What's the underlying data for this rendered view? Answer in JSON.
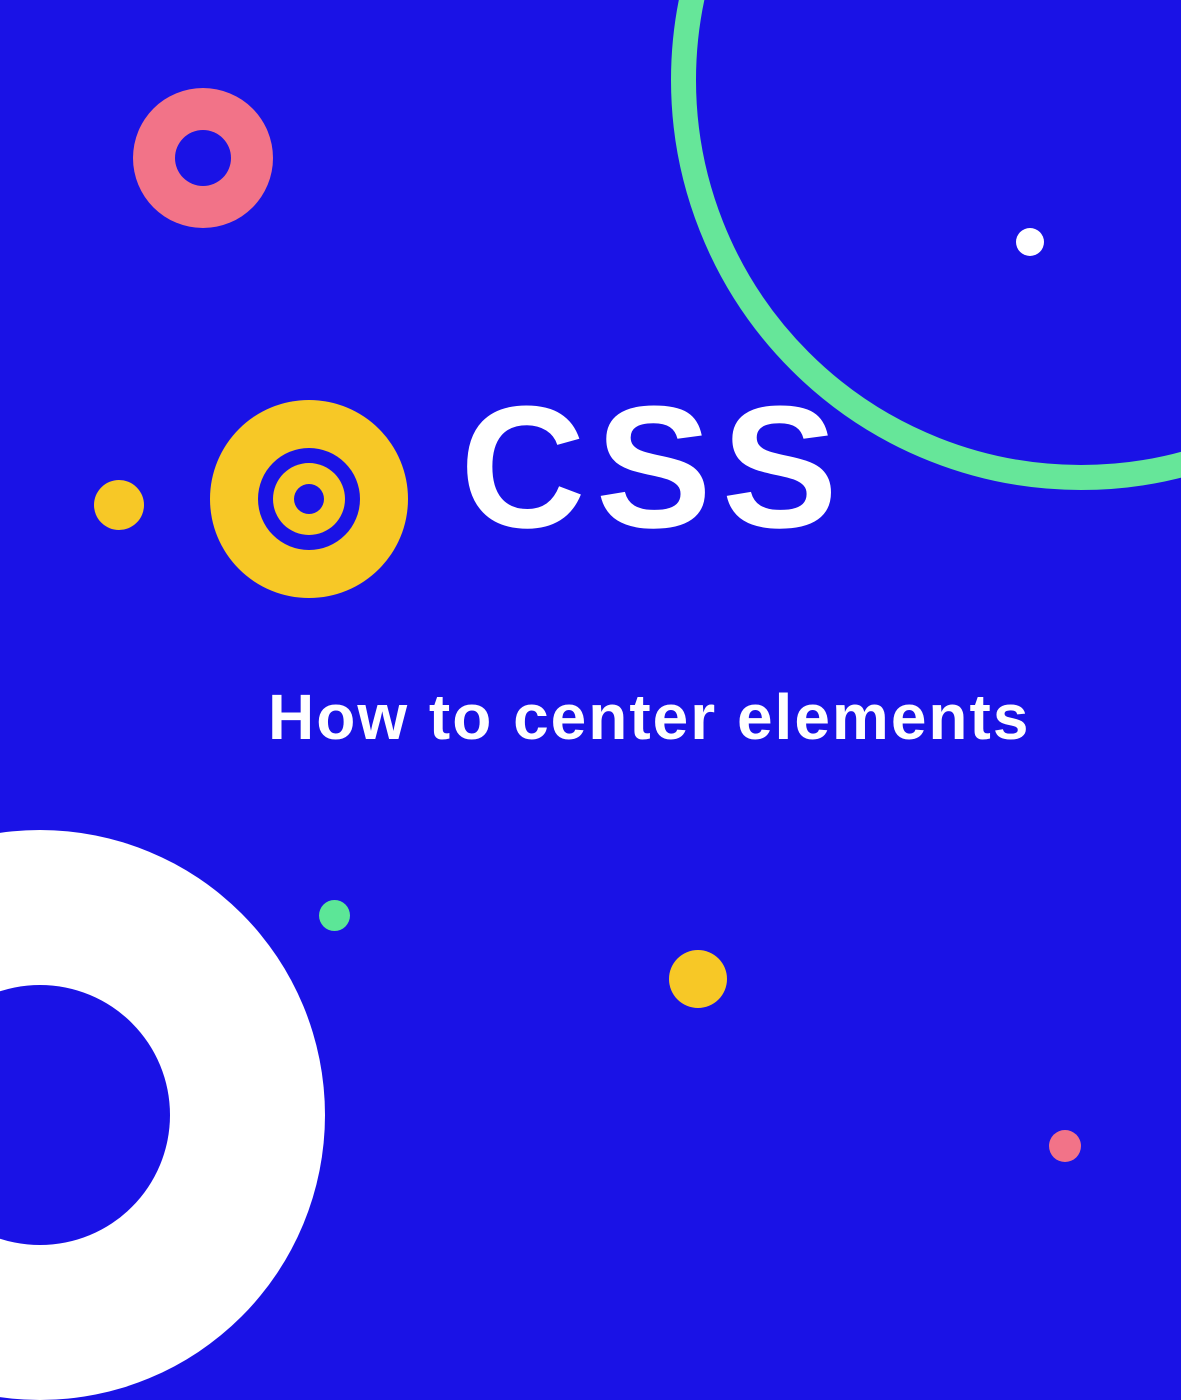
{
  "title": "CSS",
  "subtitle": "How to center elements",
  "colors": {
    "background": "#1a12e6",
    "pink": "#f27388",
    "yellow": "#f7c826",
    "green": "#66e699",
    "white": "#ffffff"
  }
}
